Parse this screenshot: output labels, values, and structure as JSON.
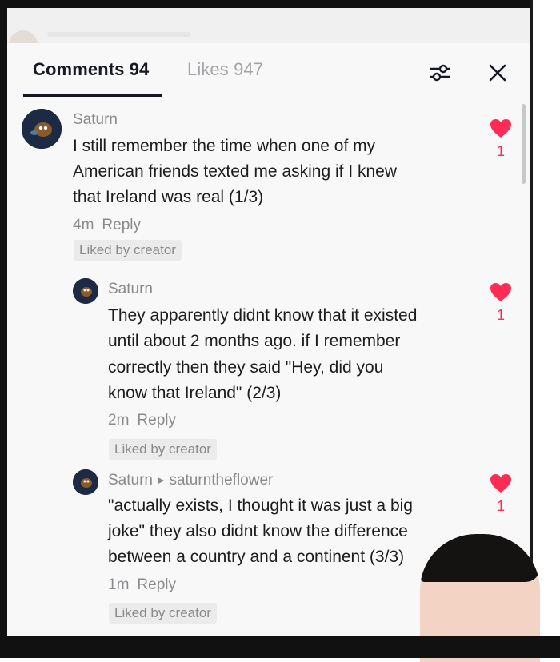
{
  "header": {
    "comments_label": "Comments 94",
    "likes_label": "Likes 947",
    "filter_icon": "filter-sliders-icon",
    "close_icon": "close-icon"
  },
  "comments": [
    {
      "username": "Saturn",
      "lines": [
        "I still remember the time when one of my",
        "American friends texted me asking if I knew",
        "that Ireland was real (1/3)"
      ],
      "time": "4m",
      "reply_label": "Reply",
      "badge": "Liked by creator",
      "likes": "1"
    },
    {
      "username": "Saturn",
      "lines": [
        "They apparently didnt know that it existed",
        "until about 2 months ago. if I remember",
        "correctly then they said \"Hey, did you",
        "know that Ireland\" (2/3)"
      ],
      "time": "2m",
      "reply_label": "Reply",
      "badge": "Liked by creator",
      "likes": "1"
    },
    {
      "username": "Saturn",
      "reply_to": "saturntheflower",
      "lines": [
        "\"actually exists, I thought it was just a big",
        "joke\" they also didnt know the difference",
        "between a country and a continent (3/3)"
      ],
      "time": "1m",
      "reply_label": "Reply",
      "badge": "Liked by creator",
      "likes": "1"
    }
  ],
  "colors": {
    "accent": "#fe2c55",
    "muted_text": "#8a8a8e",
    "primary_text": "#161823"
  }
}
